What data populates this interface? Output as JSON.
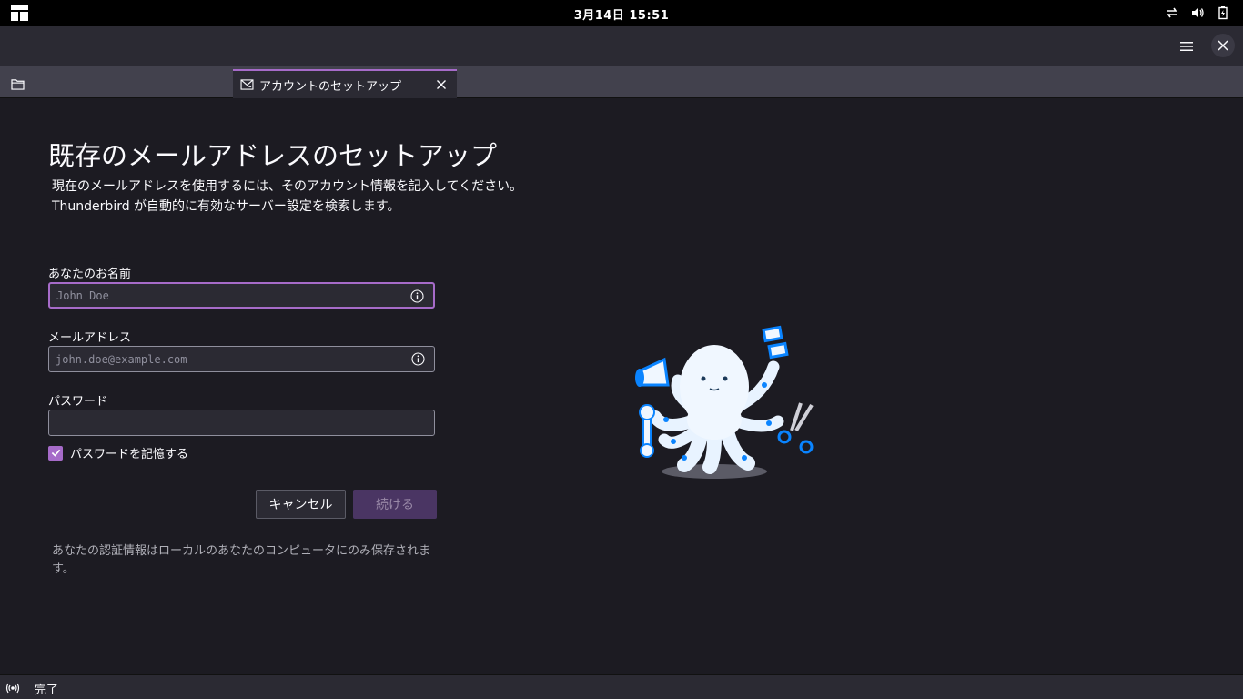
{
  "system_bar": {
    "clock": "3月14日  15:51",
    "tray_icons": [
      "network-icon",
      "volume-icon",
      "battery-icon"
    ]
  },
  "tabs": [
    {
      "icon": "folder-icon",
      "label": ""
    },
    {
      "icon": "mail-setup-icon",
      "label": "アカウントのセットアップ",
      "active": true
    }
  ],
  "setup": {
    "title": "既存のメールアドレスのセットアップ",
    "description_line1": "現在のメールアドレスを使用するには、そのアカウント情報を記入してください。",
    "description_line2": "Thunderbird が自動的に有効なサーバー設定を検索します。",
    "name_label": "あなたのお名前",
    "name_value": "",
    "name_placeholder": "John Doe",
    "email_label": "メールアドレス",
    "email_value": "",
    "email_placeholder": "john.doe@example.com",
    "password_label": "パスワード",
    "password_value": "",
    "remember_label": "パスワードを記憶する",
    "remember_checked": true,
    "cancel_label": "キャンセル",
    "continue_label": "続ける",
    "footnote": "あなたの認証情報はローカルのあなたのコンピュータにのみ保存されます。"
  },
  "status": {
    "text": "完了"
  },
  "colors": {
    "accent": "#a66bc9",
    "background": "#1c1b22",
    "toolbar": "#2b2a33",
    "mascot_blue": "#0a84ff"
  }
}
